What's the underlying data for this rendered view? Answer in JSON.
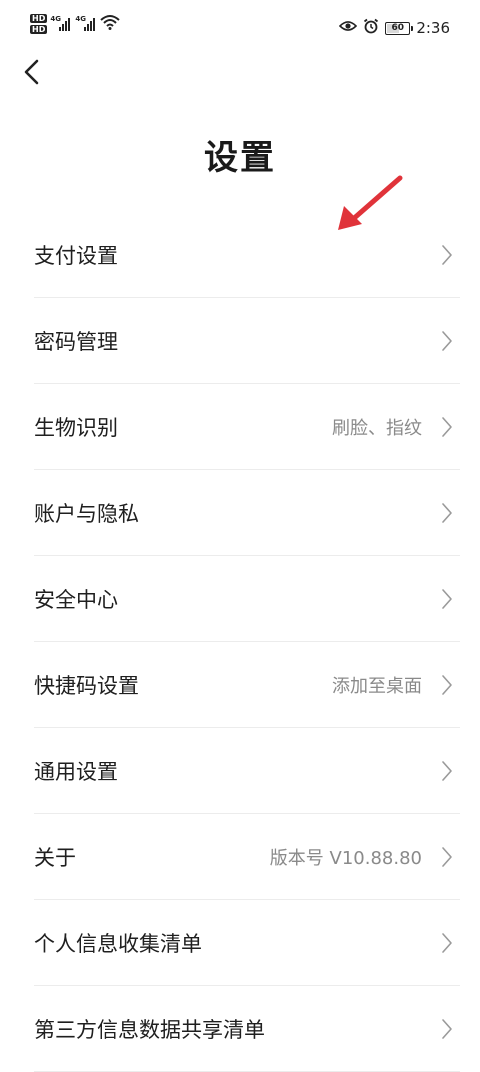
{
  "status_bar": {
    "badge_top": "HD",
    "badge_bottom": "HD",
    "net_1": "4G",
    "net_2": "4G",
    "battery": "60",
    "battery_level_percent": 60,
    "time": "2:36"
  },
  "header": {
    "title": "设置"
  },
  "settings": {
    "items": [
      {
        "label": "支付设置",
        "value": ""
      },
      {
        "label": "密码管理",
        "value": ""
      },
      {
        "label": "生物识别",
        "value": "刷脸、指纹"
      },
      {
        "label": "账户与隐私",
        "value": ""
      },
      {
        "label": "安全中心",
        "value": ""
      },
      {
        "label": "快捷码设置",
        "value": "添加至桌面"
      },
      {
        "label": "通用设置",
        "value": ""
      },
      {
        "label": "关于",
        "value": "版本号 V10.88.80"
      },
      {
        "label": "个人信息收集清单",
        "value": ""
      },
      {
        "label": "第三方信息数据共享清单",
        "value": ""
      }
    ]
  },
  "colors": {
    "annotation_arrow": "#e0333a",
    "divider": "#ececec",
    "secondary_text": "#8a8a8a"
  },
  "icons": {
    "back": "chevron-left-icon",
    "row": "chevron-right-icon"
  }
}
